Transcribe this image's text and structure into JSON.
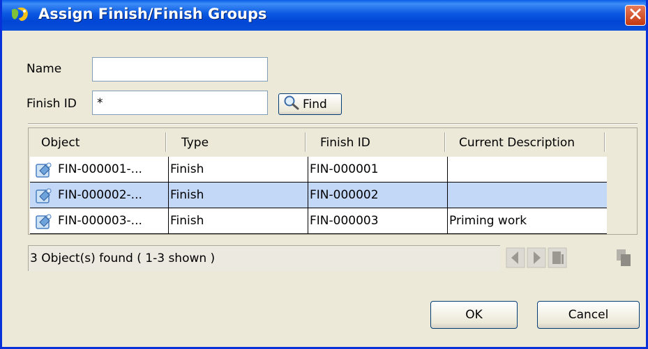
{
  "window": {
    "title": "Assign Finish/Finish Groups",
    "close_icon": "close-icon",
    "app_icon": "app-logo-icon"
  },
  "search": {
    "name_label": "Name",
    "name_value": "",
    "finish_id_label": "Finish ID",
    "finish_id_value": "*",
    "find_label": "Find",
    "find_icon": "magnifier-icon"
  },
  "table": {
    "columns": [
      "Object",
      "Type",
      "Finish ID",
      "Current Description"
    ],
    "rows": [
      {
        "object": "FIN-000001-...",
        "type": "Finish",
        "finish_id": "FIN-000001",
        "description": "",
        "selected": false
      },
      {
        "object": "FIN-000002-...",
        "type": "Finish",
        "finish_id": "FIN-000002",
        "description": "",
        "selected": true
      },
      {
        "object": "FIN-000003-...",
        "type": "Finish",
        "finish_id": "FIN-000003",
        "description": "Priming work",
        "selected": false
      }
    ],
    "row_icon": "finish-object-icon"
  },
  "status": {
    "text": "3 Object(s) found ( 1-3  shown )",
    "nav_icons": [
      "previous-page-icon",
      "next-page-icon",
      "list-icon",
      "copy-icon"
    ]
  },
  "buttons": {
    "ok_label": "OK",
    "cancel_label": "Cancel"
  },
  "colors": {
    "title_bar": "#0a58e1",
    "selected_row": "#c3d7f7",
    "dialog_bg": "#ece9d8",
    "close_button": "#c4380f"
  }
}
